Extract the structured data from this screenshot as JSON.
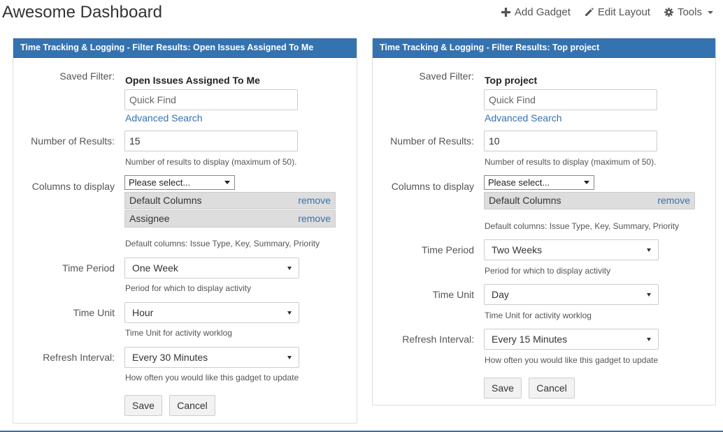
{
  "page": {
    "title": "Awesome Dashboard"
  },
  "toolbar": {
    "add_gadget": "Add Gadget",
    "edit_layout": "Edit Layout",
    "tools": "Tools"
  },
  "gadgets": [
    {
      "header": "Time Tracking & Logging - Filter Results: Open Issues Assigned To Me",
      "saved_filter_label": "Saved Filter:",
      "saved_filter_value": "Open Issues Assigned To Me",
      "quick_find_placeholder": "Quick Find",
      "advanced_search": "Advanced Search",
      "num_results_label": "Number of Results:",
      "num_results_value": "15",
      "num_results_help": "Number of results to display (maximum of 50).",
      "columns_label": "Columns to display",
      "columns_select": "Please select...",
      "columns": [
        {
          "name": "Default Columns",
          "remove": "remove"
        },
        {
          "name": "Assignee",
          "remove": "remove"
        }
      ],
      "columns_help": "Default columns: Issue Type, Key, Summary, Priority",
      "time_period_label": "Time Period",
      "time_period_value": "One Week",
      "time_period_help": "Period for which to display activity",
      "time_unit_label": "Time Unit",
      "time_unit_value": "Hour",
      "time_unit_help": "Time Unit for activity worklog",
      "refresh_label": "Refresh Interval:",
      "refresh_value": "Every 30 Minutes",
      "refresh_help": "How often you would like this gadget to update",
      "save": "Save",
      "cancel": "Cancel"
    },
    {
      "header": "Time Tracking & Logging - Filter Results: Top project",
      "saved_filter_label": "Saved Filter:",
      "saved_filter_value": "Top project",
      "quick_find_placeholder": "Quick Find",
      "advanced_search": "Advanced Search",
      "num_results_label": "Number of Results:",
      "num_results_value": "10",
      "num_results_help": "Number of results to display (maximum of 50).",
      "columns_label": "Columns to display",
      "columns_select": "Please select...",
      "columns": [
        {
          "name": "Default Columns",
          "remove": "remove"
        }
      ],
      "columns_help": "Default columns: Issue Type, Key, Summary, Priority",
      "time_period_label": "Time Period",
      "time_period_value": "Two Weeks",
      "time_period_help": "Period for which to display activity",
      "time_unit_label": "Time Unit",
      "time_unit_value": "Day",
      "time_unit_help": "Time Unit for activity worklog",
      "refresh_label": "Refresh Interval:",
      "refresh_value": "Every 15 Minutes",
      "refresh_help": "How often you would like this gadget to update",
      "save": "Save",
      "cancel": "Cancel"
    }
  ]
}
